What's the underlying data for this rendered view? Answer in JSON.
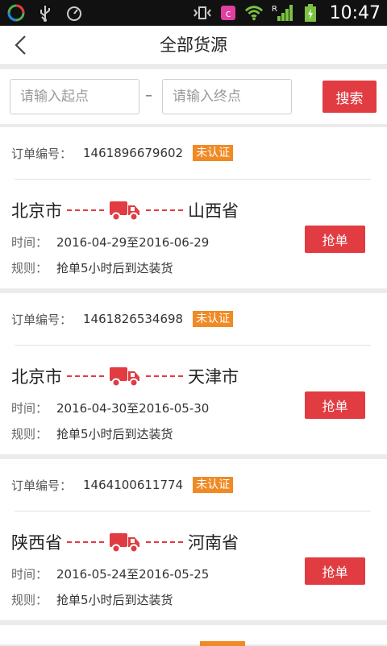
{
  "status_bar": {
    "time": "10:47",
    "network_label": "R"
  },
  "nav": {
    "title": "全部货源"
  },
  "search": {
    "start_placeholder": "请输入起点",
    "separator": "–",
    "end_placeholder": "请输入终点",
    "button_label": "搜索"
  },
  "orders": [
    {
      "order_label": "订单编号：",
      "order_number": "1461896679602",
      "badge": "未认证",
      "from": "北京市",
      "to": "山西省",
      "time_label": "时间：",
      "time": "2016-04-29至2016-06-29",
      "rule_label": "规则：",
      "rule": "抢单5小时后到达装货",
      "button_label": "抢单"
    },
    {
      "order_label": "订单编号：",
      "order_number": "1461826534698",
      "badge": "未认证",
      "from": "北京市",
      "to": "天津市",
      "time_label": "时间：",
      "time": "2016-04-30至2016-05-30",
      "rule_label": "规则：",
      "rule": "抢单5小时后到达装货",
      "button_label": "抢单"
    },
    {
      "order_label": "订单编号：",
      "order_number": "1464100611774",
      "badge": "未认证",
      "from": "陕西省",
      "to": "河南省",
      "time_label": "时间：",
      "time": "2016-05-24至2016-05-25",
      "rule_label": "规则：",
      "rule": "抢单5小时后到达装货",
      "button_label": "抢单"
    }
  ],
  "colors": {
    "accent": "#e03c42",
    "badge": "#f08a24",
    "background": "#ebebeb"
  }
}
